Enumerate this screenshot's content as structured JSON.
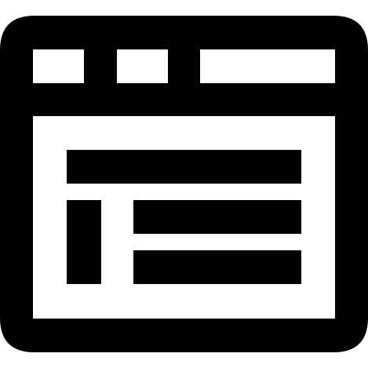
{
  "icon": {
    "name": "browser-window-layout-icon",
    "foreground": "#000000",
    "background": "#ffffff"
  }
}
